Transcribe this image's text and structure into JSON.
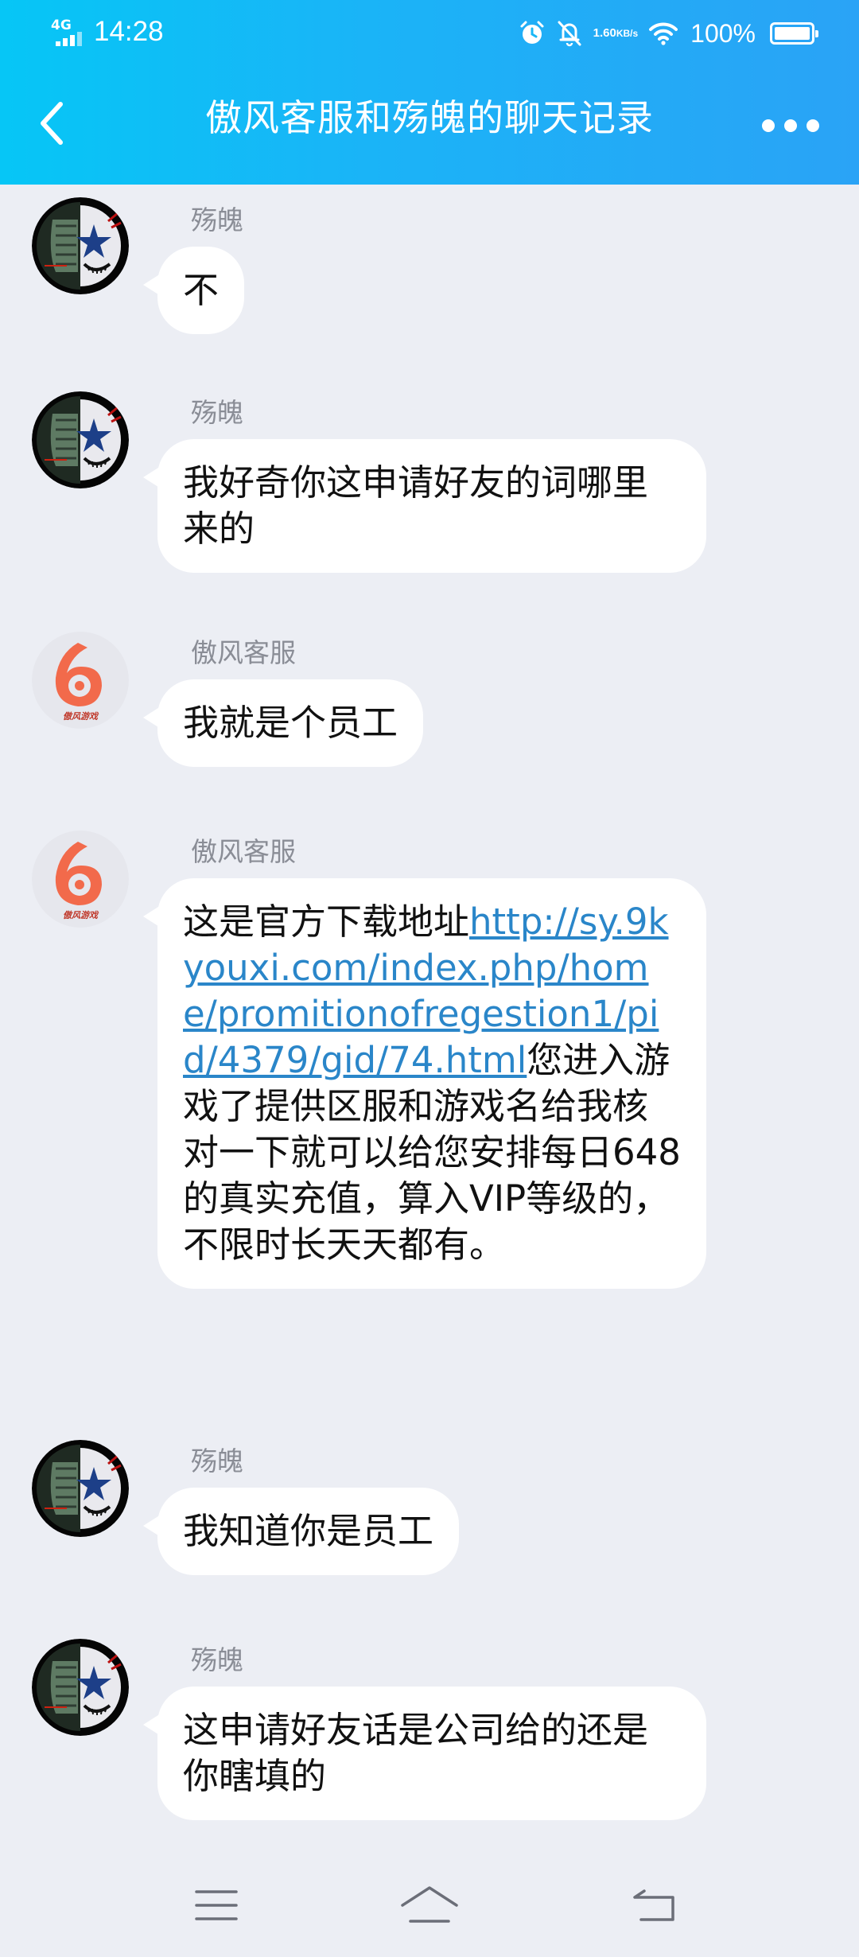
{
  "status_bar": {
    "network": "4G",
    "time": "14:28",
    "net_speed_value": "1.60",
    "net_speed_unit": "KB/s",
    "battery": "100%"
  },
  "header": {
    "title": "傲风客服和殇魄的聊天记录"
  },
  "messages": [
    {
      "sender": "殇魄",
      "text": "不"
    },
    {
      "sender": "殇魄",
      "text": "我好奇你这申请好友的词哪里来的"
    },
    {
      "sender": "傲风客服",
      "text": "我就是个员工"
    },
    {
      "sender": "傲风客服",
      "text_before": "这是官方下载地址",
      "link": "http://sy.9kyouxi.com/index.php/home/promitionofregestion1/pid/4379/gid/74.html",
      "text_after": "您进入游戏了提供区服和游戏名给我核对一下就可以给您安排每日648的真实充值，算入VIP等级的，不限时长天天都有。"
    },
    {
      "sender": "殇魄",
      "text": "我知道你是员工"
    },
    {
      "sender": "殇魄",
      "text": "这申请好友话是公司给的还是你瞎填的"
    }
  ],
  "avatar_badge_text": "傲风游戏",
  "colors": {
    "header_start": "#06c6f6",
    "header_end": "#2aa3f6",
    "background": "#eceef4",
    "link": "#2a86c9",
    "agent_logo": "#f26a4b"
  },
  "icons": {
    "back": "chevron-left-icon",
    "more": "more-dots-icon",
    "nav_menu": "menu-icon",
    "nav_home": "home-icon",
    "nav_back": "back-icon"
  }
}
